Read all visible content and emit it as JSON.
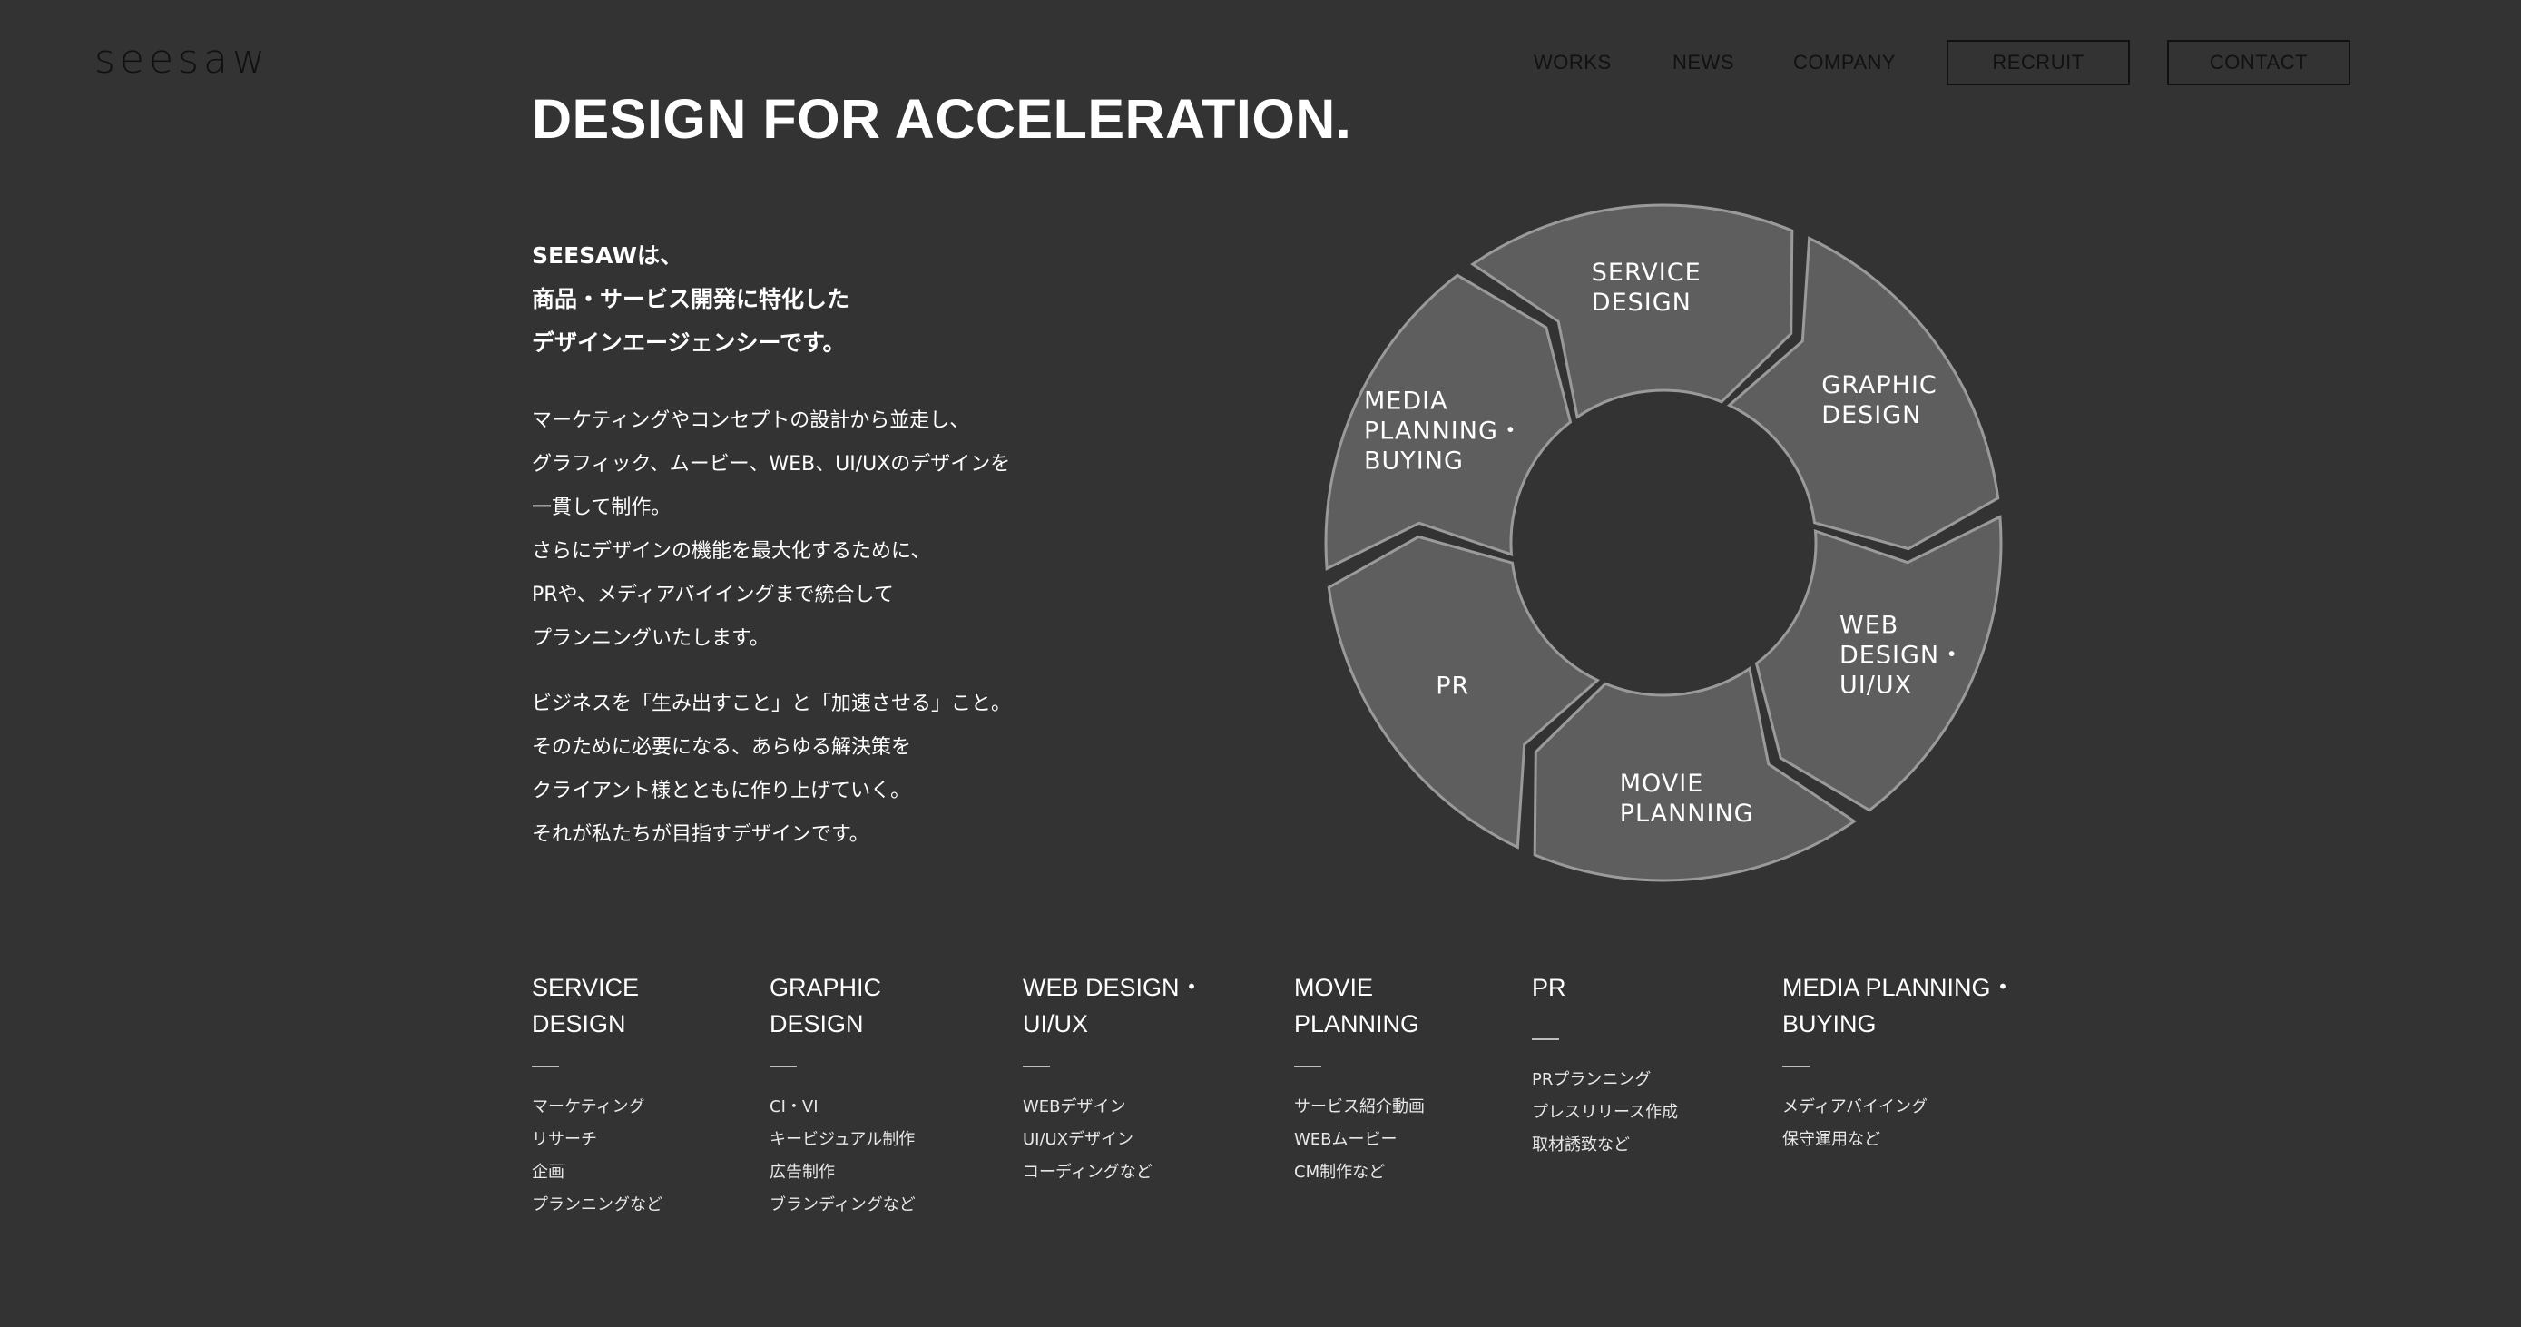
{
  "header": {
    "logo": "seesaw",
    "nav": [
      "WORKS",
      "NEWS",
      "COMPANY"
    ],
    "buttons": [
      "RECRUIT",
      "CONTACT"
    ]
  },
  "hero": {
    "title": "DESIGN FOR ACCELERATION."
  },
  "intro": {
    "lead": [
      "SEESAWは、",
      "商品・サービス開発に特化した",
      "デザインエージェンシーです。"
    ],
    "paragraph1": [
      "マーケティングやコンセプトの設計から並走し、",
      "グラフィック、ムービー、WEB、UI/UXのデザインを",
      "一貫して制作。",
      "さらにデザインの機能を最大化するために、",
      "PRや、メディアバイイングまで統合して",
      "プランニングいたします。"
    ],
    "paragraph2": [
      "ビジネスを「生み出すこと」と「加速させる」こと。",
      "そのために必要になる、あらゆる解決策を",
      "クライアント様とともに作り上げていく。",
      "それが私たちが目指すデザインです。"
    ]
  },
  "cycle": {
    "segments": [
      {
        "lines": [
          "SERVICE",
          "DESIGN"
        ]
      },
      {
        "lines": [
          "GRAPHIC",
          "DESIGN"
        ]
      },
      {
        "lines": [
          "WEB",
          "DESIGN・",
          "UI/UX"
        ]
      },
      {
        "lines": [
          "MOVIE",
          "PLANNING"
        ]
      },
      {
        "lines": [
          "PR"
        ]
      },
      {
        "lines": [
          "MEDIA",
          "PLANNING・",
          "BUYING"
        ]
      }
    ],
    "colors": {
      "segment": "#5e5e5e",
      "outline": "#9a9a9a",
      "background": "#333333"
    }
  },
  "services": [
    {
      "title": [
        "SERVICE",
        "DESIGN"
      ],
      "items": [
        "マーケティング",
        "リサーチ",
        "企画",
        "プランニングなど"
      ]
    },
    {
      "title": [
        "GRAPHIC",
        "DESIGN"
      ],
      "items": [
        "CI・VI",
        "キービジュアル制作",
        "広告制作",
        "ブランディングなど"
      ]
    },
    {
      "title": [
        "WEB DESIGN・",
        "UI/UX"
      ],
      "items": [
        "WEBデザイン",
        "UI/UXデザイン",
        "コーディングなど"
      ]
    },
    {
      "title": [
        "MOVIE",
        "PLANNING"
      ],
      "items": [
        "サービス紹介動画",
        "WEBムービー",
        "CM制作など"
      ]
    },
    {
      "title": [
        "PR"
      ],
      "items": [
        "PRプランニング",
        "プレスリリース作成",
        "取材誘致など"
      ]
    },
    {
      "title": [
        "MEDIA PLANNING・",
        "BUYING"
      ],
      "items": [
        "メディアバイイング",
        "保守運用など"
      ]
    }
  ]
}
